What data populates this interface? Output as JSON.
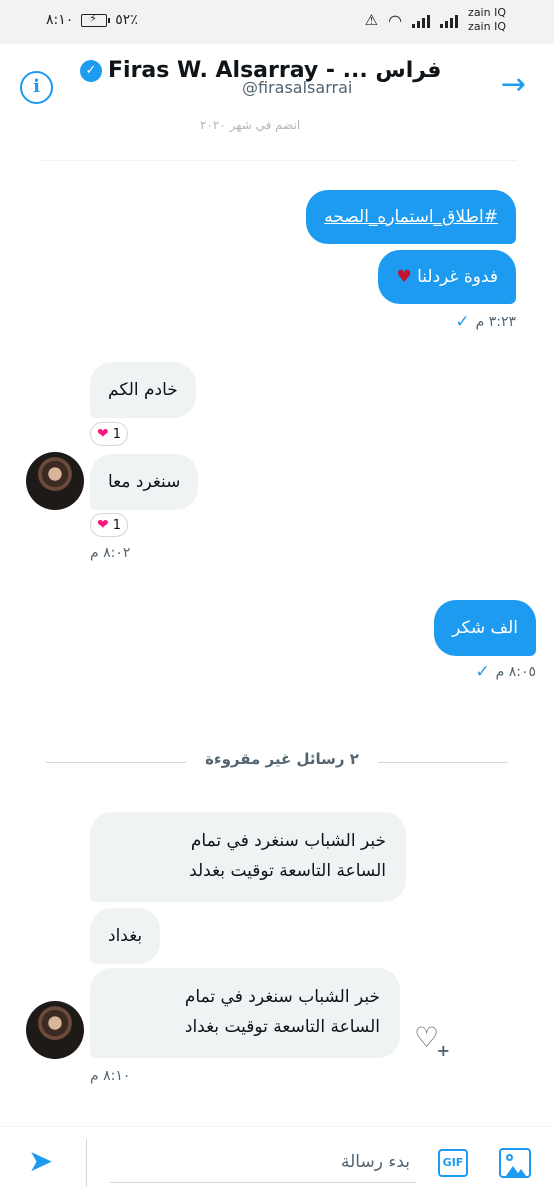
{
  "status_bar": {
    "time": "٨:١٠",
    "battery": "٥٢٪",
    "carrier_1": "zain IQ",
    "carrier_2": "zain IQ"
  },
  "header": {
    "title": "Firas W. Alsarray - ... فراس",
    "handle": "@firasalsarrai",
    "faded_text": "انضم في شهر ٢٠٢٠"
  },
  "messages": {
    "m1_hashtag": "#اطلاق_استماره_الصحه",
    "m2_text": "فدوة غردلنا",
    "m2_emoji": "♥",
    "time_1": "٣:٢٣ م",
    "m3_text": "خادم الكم",
    "m3_reaction_count": "1",
    "m4_text": "سنغرد معا",
    "m4_reaction_count": "1",
    "time_2": "٨:٠٢ م",
    "m5_text": "الف شكر",
    "time_3": "٨:٠٥ م",
    "unread_divider": "٢ رسائل غير مقروءة",
    "m6_line1": "خبر الشباب سنغرد في تمام",
    "m6_line2": "الساعة التاسعة توقيت بغدلد",
    "m7_text": "بغداد",
    "m8_line1": "خبر الشباب سنغرد في تمام",
    "m8_line2": "الساعة التاسعة توقيت بغداد",
    "time_4": "٨:١٠ م"
  },
  "composer": {
    "placeholder": "بدء رسالة",
    "gif_label": "GIF"
  },
  "icons": {
    "accent_color": "#1d9bf0",
    "reaction_heart_color": "#f91880"
  }
}
